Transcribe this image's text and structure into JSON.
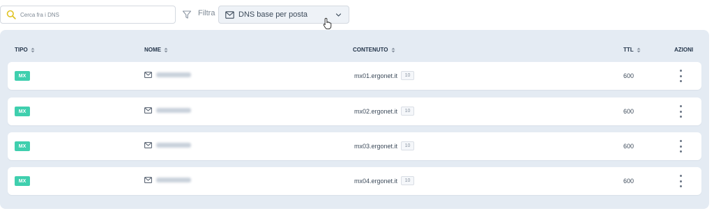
{
  "toolbar": {
    "search_placeholder": "Cerca fra i DNS",
    "filter_label": "Filtra",
    "filter_selected": "DNS base per posta"
  },
  "table": {
    "columns": [
      {
        "key": "tipo",
        "label": "TIPO",
        "sortable": true
      },
      {
        "key": "nome",
        "label": "NOME",
        "sortable": true
      },
      {
        "key": "contenuto",
        "label": "CONTENUTO",
        "sortable": true
      },
      {
        "key": "ttl",
        "label": "TTL",
        "sortable": true
      },
      {
        "key": "azioni",
        "label": "AZIONI",
        "sortable": false
      }
    ],
    "rows": [
      {
        "type": "MX",
        "content": "mx01.ergonet.it",
        "priority": "10",
        "ttl": "600"
      },
      {
        "type": "MX",
        "content": "mx02.ergonet.it",
        "priority": "10",
        "ttl": "600"
      },
      {
        "type": "MX",
        "content": "mx03.ergonet.it",
        "priority": "10",
        "ttl": "600"
      },
      {
        "type": "MX",
        "content": "mx04.ergonet.it",
        "priority": "10",
        "ttl": "600"
      }
    ]
  },
  "icons": {
    "search": "search-icon",
    "filter": "filter-icon",
    "mail": "mail-icon",
    "chevron": "chevron-down-icon",
    "sort": "sort-icon",
    "actions": "kebab-menu-icon",
    "cursor": "hand-pointer-icon"
  },
  "colors": {
    "badge_mx": "#3fcfae",
    "panel_bg": "#e4ebf3",
    "search_icon": "#e0c323",
    "header_text": "#24354a"
  }
}
